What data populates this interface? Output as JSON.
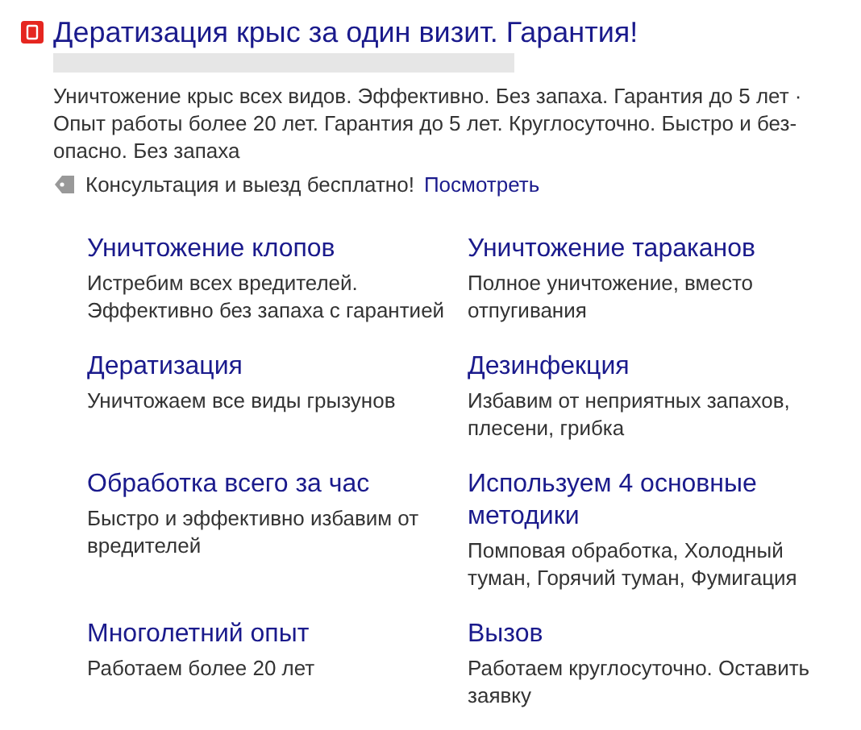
{
  "ad": {
    "title": "Дератизация крыс за один визит. Гарантия!",
    "description_lines": [
      "Уничтожение крыс всех видов. Эффективно. Без запаха. Гарантия до 5 лет ·",
      "Опыт работы более 20 лет. Гарантия до 5 лет. Круглосуточно. Быстро и без-",
      "опасно. Без запаха"
    ],
    "promo": {
      "text": "Консультация и выезд бесплатно!",
      "link": "Посмотреть"
    }
  },
  "sitelinks": [
    {
      "title": "Уничтожение клопов",
      "description": "Истребим всех вредителей. Эффективно без запаха с гарантией"
    },
    {
      "title": "Уничтожение тараканов",
      "description": "Полное уничтожение, вместо отпугивания"
    },
    {
      "title": "Дератизация",
      "description": "Уничтожаем все виды грызунов"
    },
    {
      "title": "Дезинфекция",
      "description": "Избавим от неприятных запахов, плесени, грибка"
    },
    {
      "title": "Обработка всего за час",
      "description": "Быстро и эффективно избавим от вредителей"
    },
    {
      "title": "Используем 4 основные методики",
      "description": "Помповая обработка, Холодный туман, Горячий туман, Фумигация"
    },
    {
      "title": "Многолетний опыт",
      "description": "Работаем более 20 лет"
    },
    {
      "title": "Вызов",
      "description": "Работаем круглосуточно. Оставить заявку"
    }
  ]
}
